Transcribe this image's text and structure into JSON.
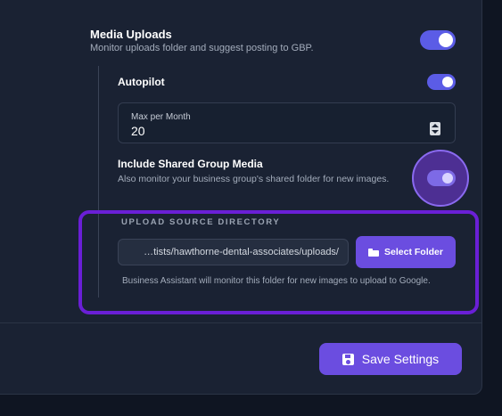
{
  "media_uploads": {
    "title": "Media Uploads",
    "description": "Monitor uploads folder and suggest posting to GBP.",
    "enabled": true
  },
  "autopilot": {
    "title": "Autopilot",
    "enabled": true
  },
  "max_per_month": {
    "label": "Max per Month",
    "value": "20"
  },
  "shared_group_media": {
    "title": "Include Shared Group Media",
    "description": "Also monitor your business group's shared folder for new images.",
    "enabled": true
  },
  "upload_source": {
    "label": "UPLOAD SOURCE DIRECTORY",
    "path_value": "…tists/hawthorne-dental-associates/uploads/",
    "select_button_label": "Select Folder",
    "help_text": "Business Assistant will monitor this folder for new images to upload to Google."
  },
  "footer": {
    "save_label": "Save Settings"
  },
  "colors": {
    "accent": "#6b4de0",
    "toggle_on": "#5b5ce6",
    "highlight": "#6a1fd6",
    "background": "#1a2233"
  },
  "icons": {
    "select_folder": "folder-open-icon",
    "save": "floppy-disk-icon"
  }
}
